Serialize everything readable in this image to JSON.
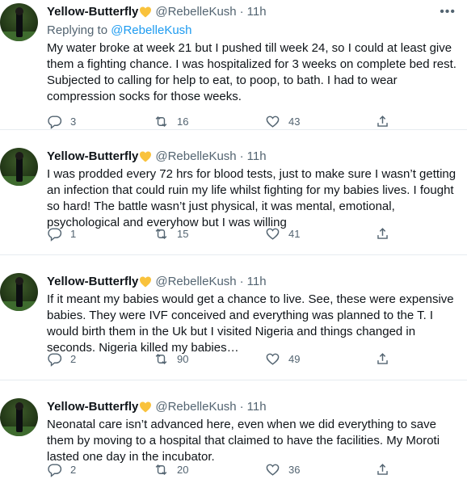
{
  "tweets": [
    {
      "author_name": "Yellow-Butterfly",
      "author_handle": "@RebelleKush",
      "separator": "·",
      "time": "11h",
      "replying_prefix": "Replying to ",
      "replying_to": "@RebelleKush",
      "text": "My water broke at week 21 but I pushed till week 24, so I could at least give them a fighting chance. I was hospitalized for 3 weeks on complete bed rest. Subjected to calling for help to eat, to poop, to bath. I had to wear compression socks for those weeks.",
      "replies": "3",
      "retweets": "16",
      "likes": "43"
    },
    {
      "author_name": "Yellow-Butterfly",
      "author_handle": "@RebelleKush",
      "separator": "·",
      "time": "11h",
      "text": "I was prodded every 72 hrs for blood tests, just to make sure I wasn’t getting an infection that could ruin my life whilst fighting for my babies lives. I fought so hard! The battle wasn’t just physical, it was mental, emotional, psychological and everyhow but I was willing",
      "replies": "1",
      "retweets": "15",
      "likes": "41"
    },
    {
      "author_name": "Yellow-Butterfly",
      "author_handle": "@RebelleKush",
      "separator": "·",
      "time": "11h",
      "text": "If it meant my babies would get a chance to live. See, these were expensive babies. They were IVF conceived and everything was planned to the T. I would birth them in the Uk but I visited Nigeria and things changed in seconds. Nigeria killed my babies…",
      "replies": "2",
      "retweets": "90",
      "likes": "49"
    },
    {
      "author_name": "Yellow-Butterfly",
      "author_handle": "@RebelleKush",
      "separator": "·",
      "time": "11h",
      "text": "Neonatal care isn’t advanced here, even when we did everything to save them by moving to a hospital that claimed to have the facilities. My Moroti lasted one day in the incubator.",
      "replies": "2",
      "retweets": "20",
      "likes": "36"
    }
  ],
  "more_symbol": "•••",
  "colors": {
    "text": "#0f1419",
    "secondary": "#536471",
    "link": "#1d9bf0",
    "heart_emoji": "#f9c23c",
    "divider": "#e6ecf0"
  },
  "icons": [
    "yellow-heart-icon",
    "more-icon",
    "reply-icon",
    "retweet-icon",
    "like-icon",
    "share-icon"
  ]
}
